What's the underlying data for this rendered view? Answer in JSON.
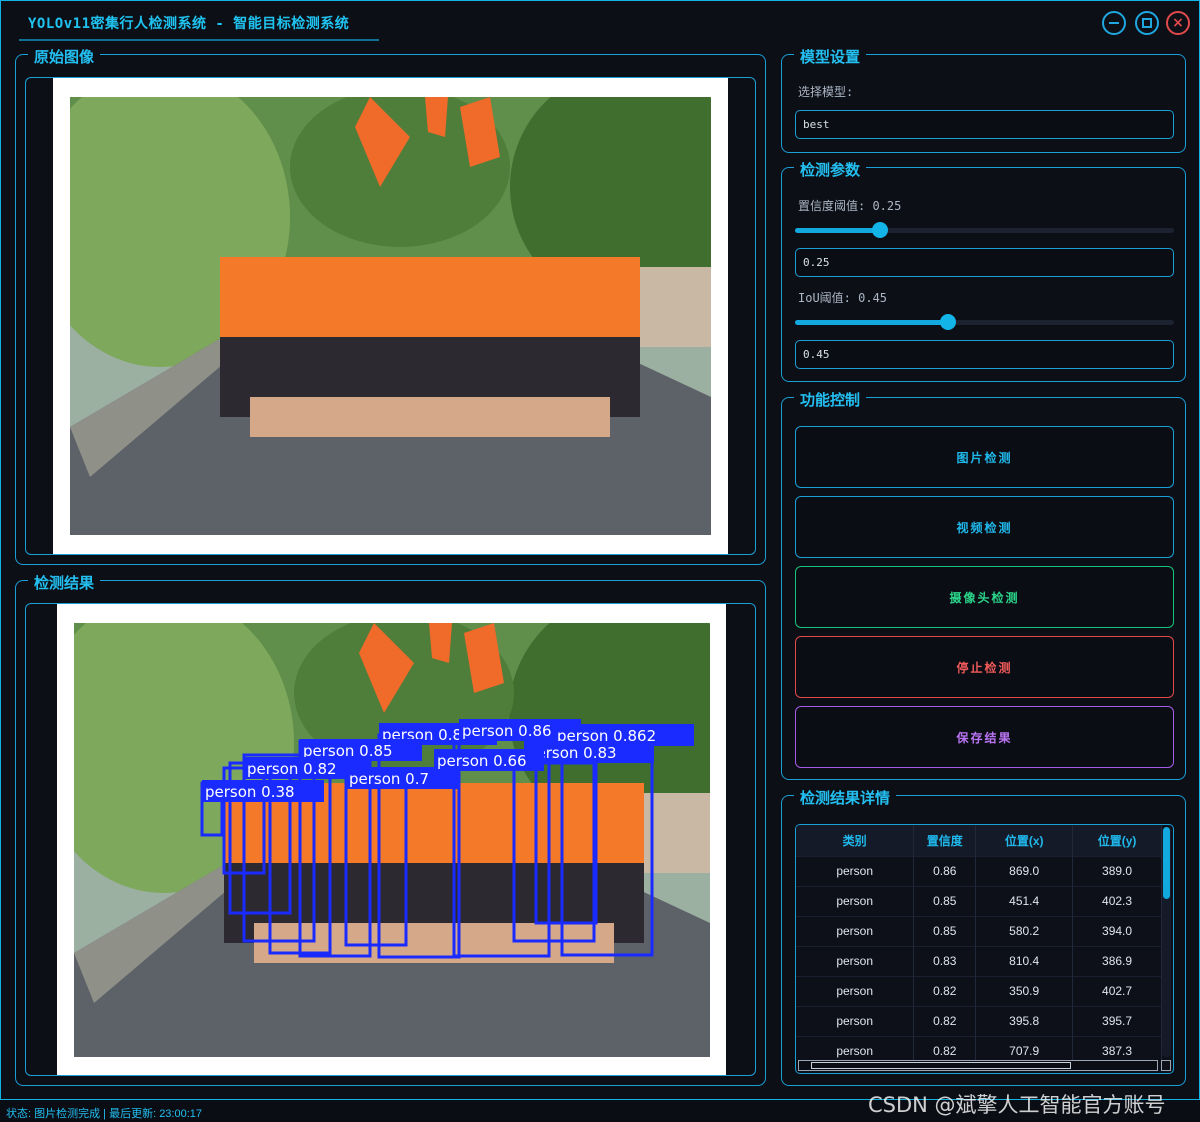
{
  "window": {
    "title": "YOLOv11密集行人检测系统 - 智能目标检测系统",
    "min_icon": "minimize-icon",
    "max_icon": "maximize-icon",
    "close_icon": "close-icon"
  },
  "panels": {
    "original_title": "原始图像",
    "result_title": "检测结果",
    "model_title": "模型设置",
    "params_title": "检测参数",
    "control_title": "功能控制",
    "details_title": "检测结果详情"
  },
  "model": {
    "select_label": "选择模型:",
    "selected": "best"
  },
  "params": {
    "conf_label": "置信度阈值: 0.25",
    "conf_value": "0.25",
    "conf_level": 0.25,
    "iou_label": "IoU阈值: 0.45",
    "iou_value": "0.45",
    "iou_level": 0.45
  },
  "buttons": {
    "image": "图片检测",
    "video": "视频检测",
    "camera": "摄像头检测",
    "stop": "停止检测",
    "save": "保存结果"
  },
  "colors": {
    "accent": "#12b3e6",
    "btn_image": "#1a9fd6",
    "btn_video": "#1a9fd6",
    "btn_camera": "#15c47a",
    "btn_stop": "#e04a4a",
    "btn_save": "#a45ce8",
    "box": "#1a2bff"
  },
  "detections": [
    {
      "text": "person 0.85"
    },
    {
      "text": "person 0.86"
    },
    {
      "text": "person 0.862"
    },
    {
      "text": "person 0.85"
    },
    {
      "text": "person 0.82"
    },
    {
      "text": "person 0.7"
    },
    {
      "text": "person 0.38"
    },
    {
      "text": "person 0.83"
    },
    {
      "text": "person 0.66"
    }
  ],
  "table": {
    "headers": [
      "类别",
      "置信度",
      "位置(x)",
      "位置(y)"
    ],
    "rows": [
      [
        "person",
        "0.86",
        "869.0",
        "389.0"
      ],
      [
        "person",
        "0.85",
        "451.4",
        "402.3"
      ],
      [
        "person",
        "0.85",
        "580.2",
        "394.0"
      ],
      [
        "person",
        "0.83",
        "810.4",
        "386.9"
      ],
      [
        "person",
        "0.82",
        "350.9",
        "402.7"
      ],
      [
        "person",
        "0.82",
        "395.8",
        "395.7"
      ],
      [
        "person",
        "0.82",
        "707.9",
        "387.3"
      ]
    ]
  },
  "status": "状态: 图片检测完成 | 最后更新: 23:00:17",
  "watermark": "CSDN @斌擎人工智能官方账号"
}
